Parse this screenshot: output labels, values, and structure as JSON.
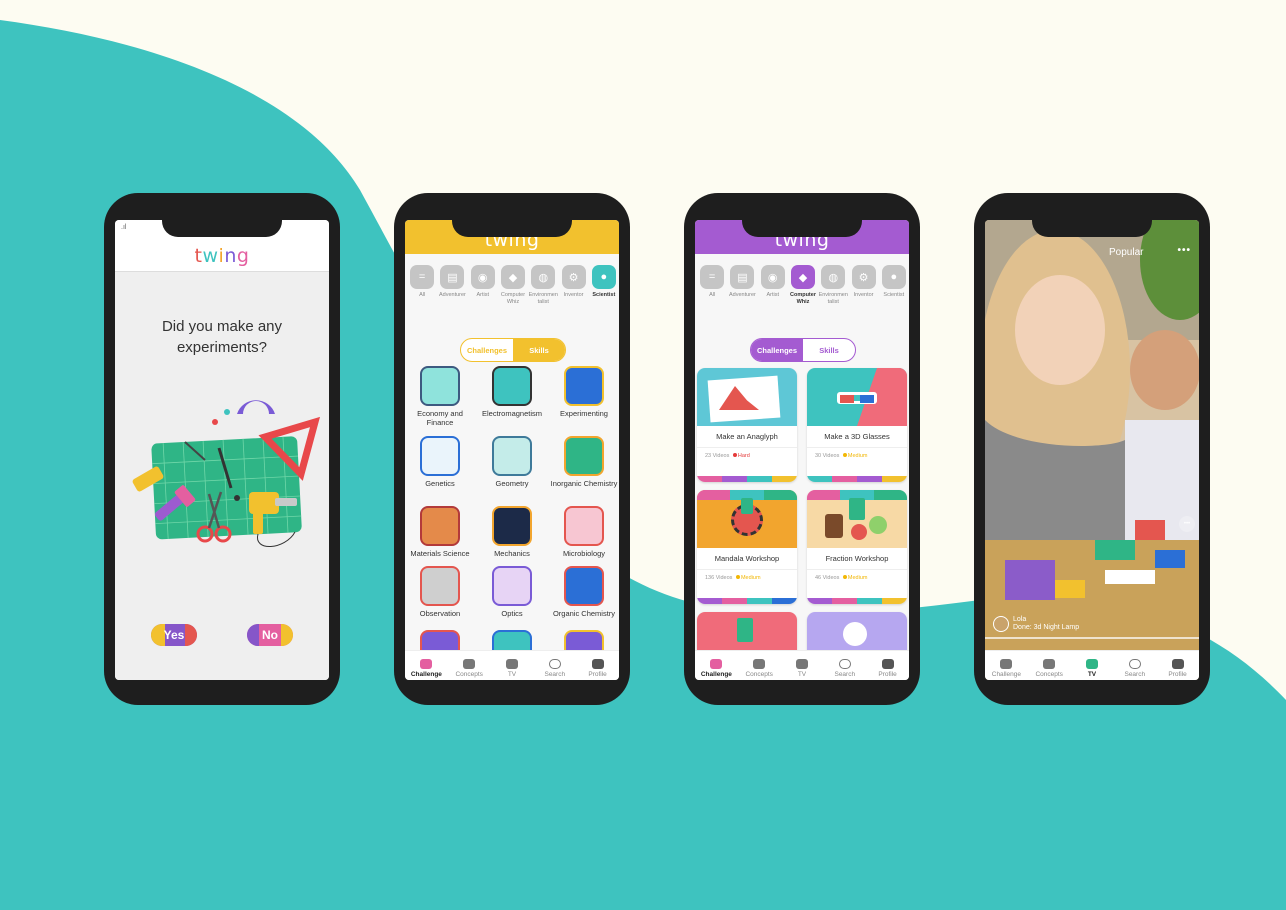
{
  "brand": {
    "logo_text": "twing"
  },
  "colors": {
    "teal": "#3ec3bf",
    "cream": "#fdfcf2",
    "yellow": "#f2c12e",
    "purple": "#a45bd1"
  },
  "phone1": {
    "signal": ".ıl",
    "question": "Did you make any experiments?",
    "yes_label": "Yes",
    "no_label": "No"
  },
  "phone2": {
    "categories": [
      "All",
      "Adventurer",
      "Artist",
      "Computer Whiz",
      "Environmentalist",
      "Inventor",
      "Scientist"
    ],
    "active_category": "Scientist",
    "segment": {
      "challenges": "Challenges",
      "skills": "Skills",
      "active": "Skills"
    },
    "skills": [
      "Economy and Finance",
      "Electromagnetism",
      "Experimenting",
      "Genetics",
      "Geometry",
      "Inorganic Chemistry",
      "Materials Science",
      "Mechanics",
      "Microbiology",
      "Observation",
      "Optics",
      "Organic Chemistry"
    ]
  },
  "phone3": {
    "categories": [
      "All",
      "Adventurer",
      "Artist",
      "Computer Whiz",
      "Environmentalist",
      "Inventor",
      "Scientist"
    ],
    "active_category": "Computer Whiz",
    "segment": {
      "challenges": "Challenges",
      "skills": "Skills",
      "active": "Challenges"
    },
    "cards": [
      {
        "title": "Make an Anaglyph",
        "videos": "23 Videos",
        "difficulty": "Hard",
        "difficulty_color": "#e53b3b"
      },
      {
        "title": "Make a 3D Glasses",
        "videos": "30 Videos",
        "difficulty": "Medium",
        "difficulty_color": "#f2b705"
      },
      {
        "title": "Mandala Workshop",
        "videos": "136 Videos",
        "difficulty": "Medium",
        "difficulty_color": "#f2b705"
      },
      {
        "title": "Fraction Workshop",
        "videos": "46 Videos",
        "difficulty": "Medium",
        "difficulty_color": "#f2b705"
      }
    ]
  },
  "phone4": {
    "tab": "Popular",
    "user_name": "Lola",
    "user_subtitle": "Done: 3d Night Lamp"
  },
  "nav": {
    "challenge": "Challenge",
    "concepts": "Concepts",
    "tv": "TV",
    "search": "Search",
    "profile": "Profile"
  }
}
